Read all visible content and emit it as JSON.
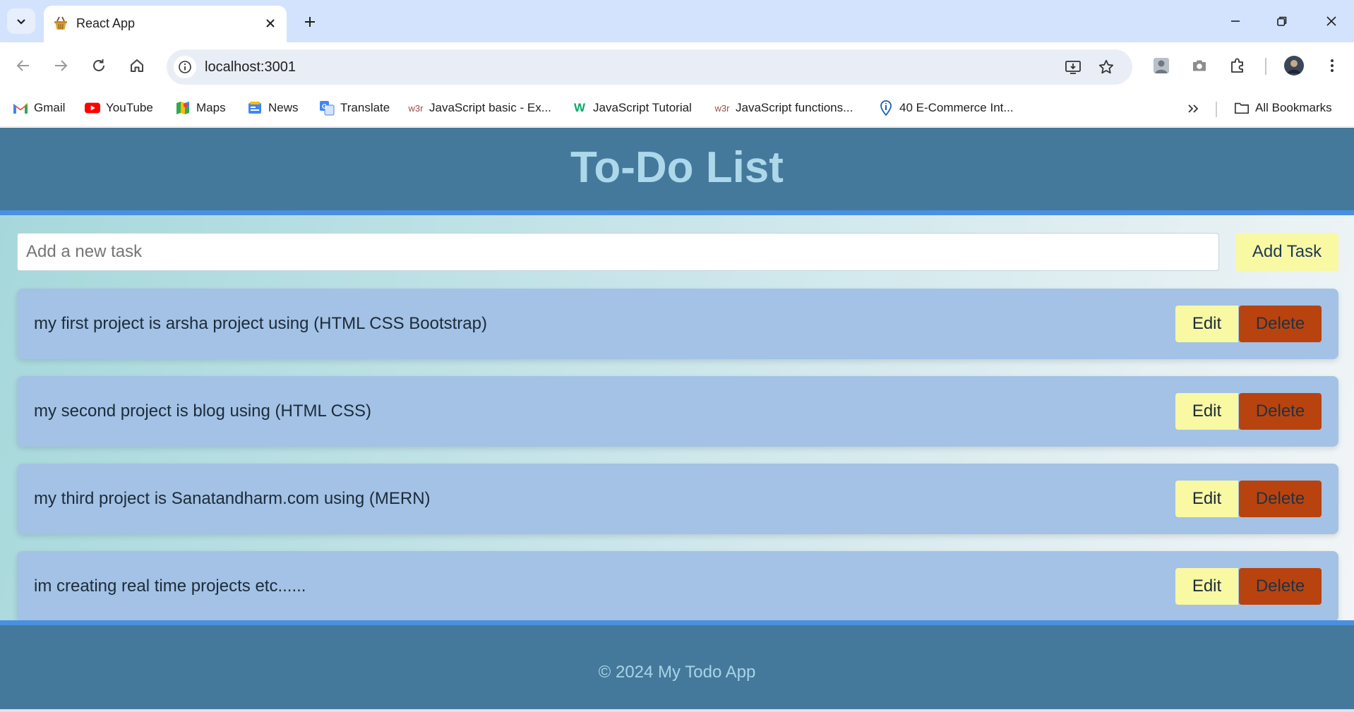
{
  "browser": {
    "tab": {
      "title": "React App",
      "favicon": "shopping-basket-icon"
    },
    "address_bar": {
      "url": "localhost:3001"
    },
    "bookmarks": [
      {
        "label": "Gmail",
        "icon": "gmail-icon"
      },
      {
        "label": "YouTube",
        "icon": "youtube-icon"
      },
      {
        "label": "Maps",
        "icon": "maps-icon"
      },
      {
        "label": "News",
        "icon": "news-icon"
      },
      {
        "label": "Translate",
        "icon": "translate-icon"
      },
      {
        "label": "JavaScript basic - Ex...",
        "icon": "w3r-icon"
      },
      {
        "label": "JavaScript Tutorial",
        "icon": "w3schools-icon"
      },
      {
        "label": "JavaScript functions...",
        "icon": "w3r-icon"
      },
      {
        "label": "40 E-Commerce Int...",
        "icon": "info-pin-icon"
      }
    ],
    "all_bookmarks_label": "All Bookmarks"
  },
  "app": {
    "title": "To-Do List",
    "input": {
      "placeholder": "Add a new task",
      "value": ""
    },
    "add_button_label": "Add Task",
    "tasks": [
      {
        "text": "my first project is arsha project using (HTML CSS Bootstrap)",
        "edit_label": "Edit",
        "delete_label": "Delete"
      },
      {
        "text": "my second project is blog using (HTML CSS)",
        "edit_label": "Edit",
        "delete_label": "Delete"
      },
      {
        "text": "my third project is Sanatandharm.com using (MERN)",
        "edit_label": "Edit",
        "delete_label": "Delete"
      },
      {
        "text": "im creating real time projects etc......",
        "edit_label": "Edit",
        "delete_label": "Delete"
      }
    ],
    "footer_text": "© 2024 My Todo App"
  },
  "colors": {
    "header_bg": "#44799c",
    "accent_border": "#4a90e2",
    "title_color": "#acd8ea",
    "task_bg": "#a3c2e5",
    "button_yellow": "#f9f8a3",
    "delete_red": "#b8430f"
  }
}
